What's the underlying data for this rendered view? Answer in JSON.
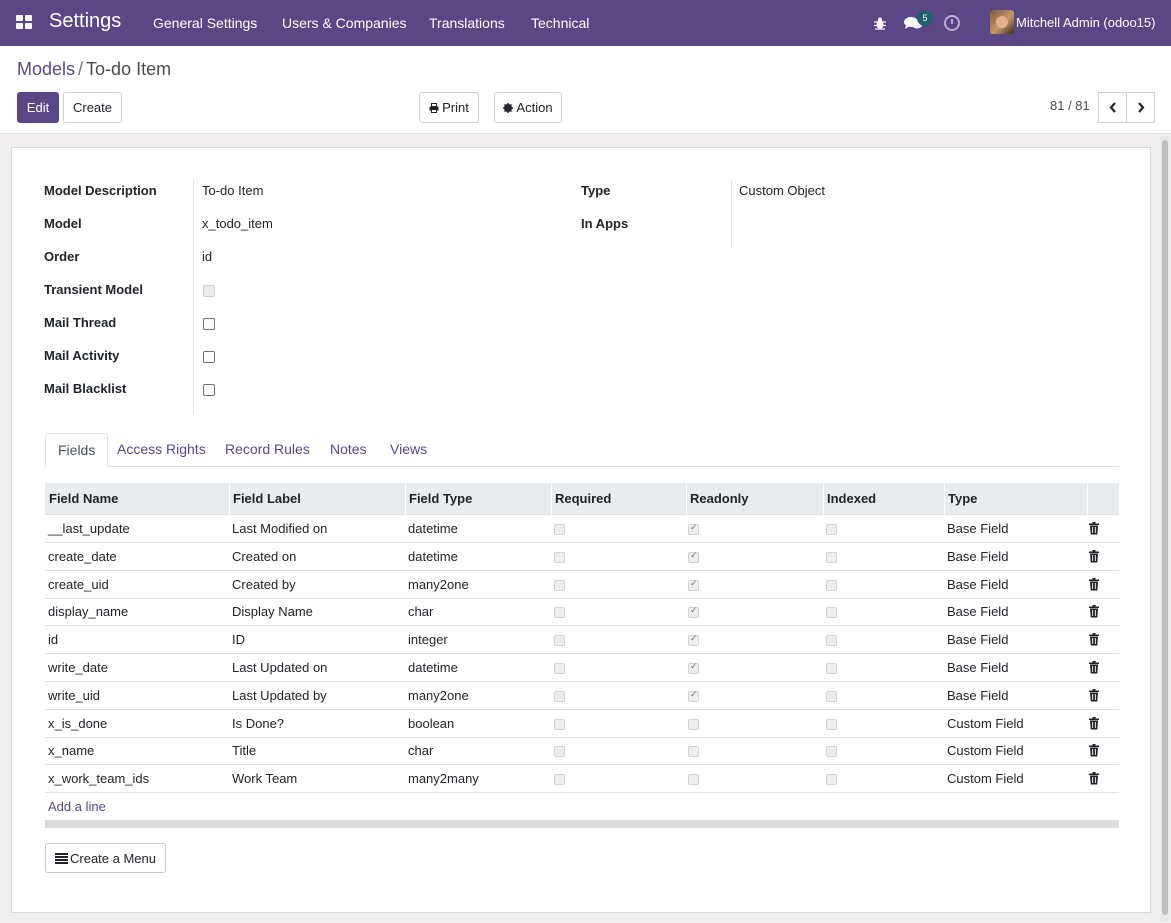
{
  "navbar": {
    "brand": "Settings",
    "menu": [
      "General Settings",
      "Users & Companies",
      "Translations",
      "Technical"
    ],
    "chat_count": "5",
    "user": "Mitchell Admin (odoo15)",
    "icons": [
      "apps-grid-icon",
      "bug-icon",
      "chat-icon",
      "clock-icon"
    ]
  },
  "breadcrumb": {
    "parent": "Models",
    "separator": "/",
    "current": "To-do Item"
  },
  "buttons": {
    "edit": "Edit",
    "create": "Create",
    "print": "Print",
    "action": "Action",
    "create_menu": "Create a Menu"
  },
  "pager": {
    "value": "81 / 81"
  },
  "form": {
    "left": [
      {
        "label": "Model Description",
        "value": "To-do Item"
      },
      {
        "label": "Model",
        "value": "x_todo_item"
      },
      {
        "label": "Order",
        "value": "id"
      },
      {
        "label": "Transient Model",
        "checkbox": false,
        "disabled": true
      },
      {
        "label": "Mail Thread",
        "checkbox": false
      },
      {
        "label": "Mail Activity",
        "checkbox": false
      },
      {
        "label": "Mail Blacklist",
        "checkbox": false
      }
    ],
    "right": [
      {
        "label": "Type",
        "value": "Custom Object"
      },
      {
        "label": "In Apps",
        "value": ""
      }
    ]
  },
  "tabs": [
    "Fields",
    "Access Rights",
    "Record Rules",
    "Notes",
    "Views"
  ],
  "table": {
    "columns": [
      "Field Name",
      "Field Label",
      "Field Type",
      "Required",
      "Readonly",
      "Indexed",
      "Type"
    ],
    "rows": [
      {
        "name": "__last_update",
        "label": "Last Modified on",
        "ftype": "datetime",
        "required": false,
        "readonly": true,
        "indexed": false,
        "type": "Base Field"
      },
      {
        "name": "create_date",
        "label": "Created on",
        "ftype": "datetime",
        "required": false,
        "readonly": true,
        "indexed": false,
        "type": "Base Field"
      },
      {
        "name": "create_uid",
        "label": "Created by",
        "ftype": "many2one",
        "required": false,
        "readonly": true,
        "indexed": false,
        "type": "Base Field"
      },
      {
        "name": "display_name",
        "label": "Display Name",
        "ftype": "char",
        "required": false,
        "readonly": true,
        "indexed": false,
        "type": "Base Field"
      },
      {
        "name": "id",
        "label": "ID",
        "ftype": "integer",
        "required": false,
        "readonly": true,
        "indexed": false,
        "type": "Base Field"
      },
      {
        "name": "write_date",
        "label": "Last Updated on",
        "ftype": "datetime",
        "required": false,
        "readonly": true,
        "indexed": false,
        "type": "Base Field"
      },
      {
        "name": "write_uid",
        "label": "Last Updated by",
        "ftype": "many2one",
        "required": false,
        "readonly": true,
        "indexed": false,
        "type": "Base Field"
      },
      {
        "name": "x_is_done",
        "label": "Is Done?",
        "ftype": "boolean",
        "required": false,
        "readonly": false,
        "indexed": false,
        "type": "Custom Field"
      },
      {
        "name": "x_name",
        "label": "Title",
        "ftype": "char",
        "required": false,
        "readonly": false,
        "indexed": false,
        "type": "Custom Field"
      },
      {
        "name": "x_work_team_ids",
        "label": "Work Team",
        "ftype": "many2many",
        "required": false,
        "readonly": false,
        "indexed": false,
        "type": "Custom Field"
      }
    ],
    "add_line": "Add a line"
  },
  "colors": {
    "brand": "#5a4785",
    "link": "#5a4785"
  }
}
